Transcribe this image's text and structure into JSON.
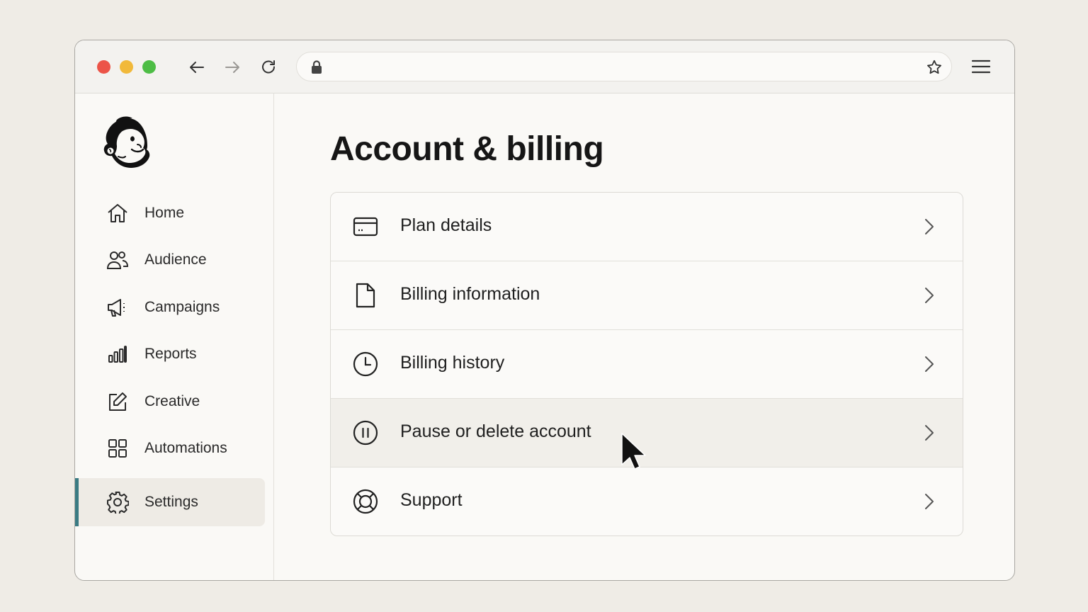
{
  "browser": {
    "url": "",
    "url_placeholder": "",
    "icons": [
      "back-arrow-icon",
      "forward-arrow-icon",
      "reload-icon",
      "lock-icon",
      "bookmark-star-icon",
      "hamburger-menu-icon"
    ]
  },
  "sidebar": {
    "logo": "mailchimp-freddie-logo",
    "items": [
      {
        "label": "Home",
        "icon": "home-icon",
        "active": false
      },
      {
        "label": "Audience",
        "icon": "audience-icon",
        "active": false
      },
      {
        "label": "Campaigns",
        "icon": "megaphone-icon",
        "active": false
      },
      {
        "label": "Reports",
        "icon": "bar-chart-icon",
        "active": false
      },
      {
        "label": "Creative",
        "icon": "edit-icon",
        "active": false
      },
      {
        "label": "Automations",
        "icon": "grid-icon",
        "active": false
      },
      {
        "label": "Settings",
        "icon": "gear-icon",
        "active": true
      }
    ]
  },
  "main": {
    "title": "Account & billing",
    "rows": [
      {
        "label": "Plan details",
        "icon": "credit-card-icon"
      },
      {
        "label": "Billing information",
        "icon": "document-icon"
      },
      {
        "label": "Billing history",
        "icon": "clock-icon"
      },
      {
        "label": "Pause or delete account",
        "icon": "pause-icon",
        "hovered": true
      },
      {
        "label": "Support",
        "icon": "lifebuoy-icon"
      }
    ]
  },
  "colors": {
    "background": "#efece6",
    "active_accent": "#3a7b83",
    "hover_row": "#f1efea",
    "traffic_red": "#ec5448",
    "traffic_yellow": "#f1b93a",
    "traffic_green": "#4dbd45"
  }
}
